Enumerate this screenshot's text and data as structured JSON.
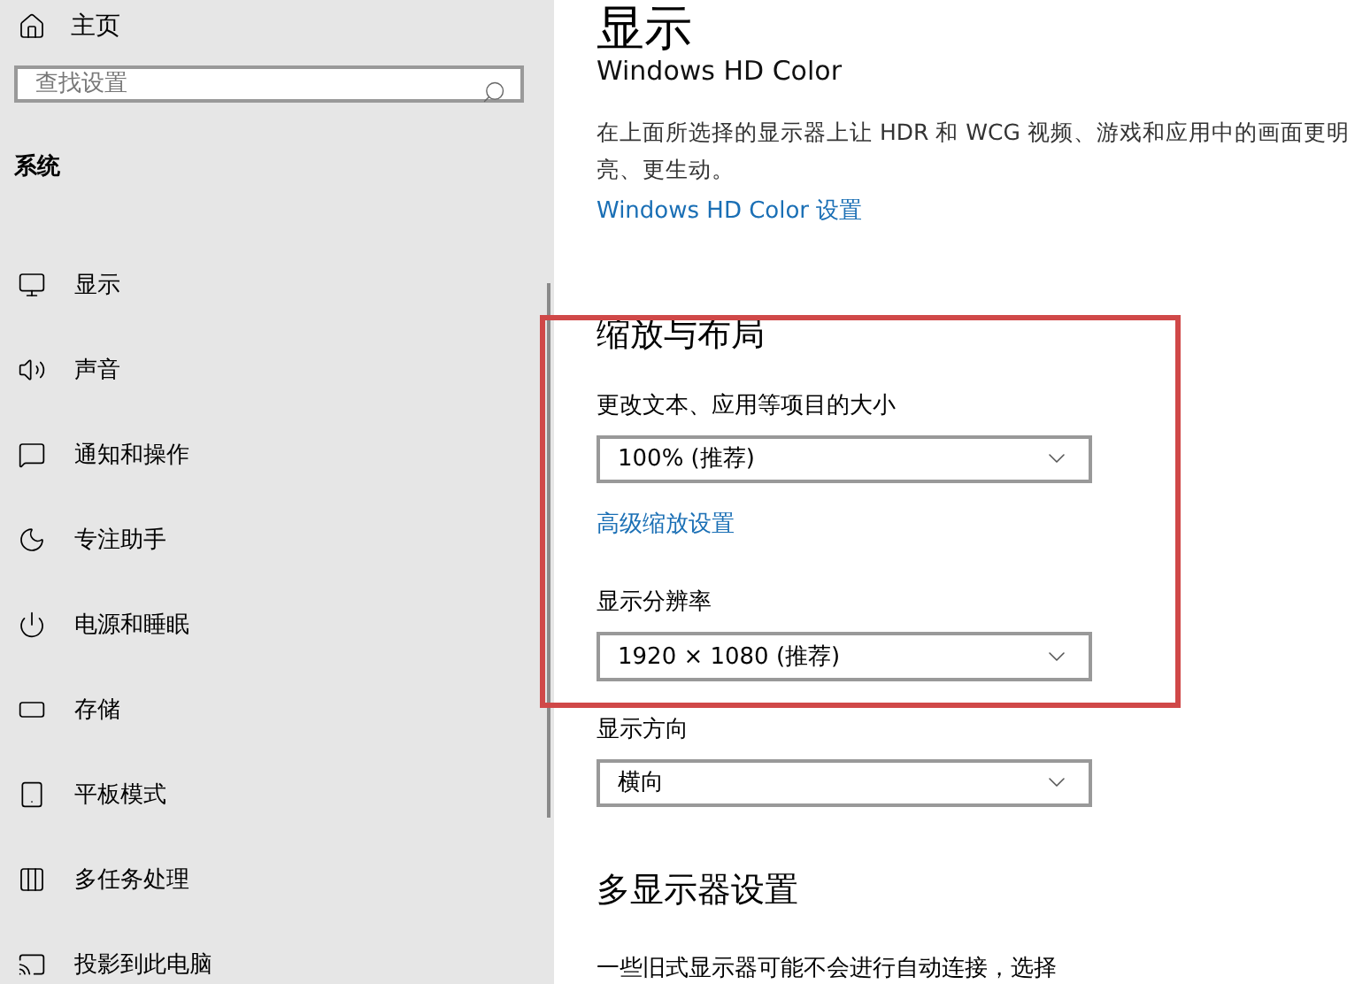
{
  "sidebar": {
    "home": "主页",
    "search": {
      "placeholder": "查找设置"
    },
    "section": "系统",
    "items": [
      {
        "label": "显示"
      },
      {
        "label": "声音"
      },
      {
        "label": "通知和操作"
      },
      {
        "label": "专注助手"
      },
      {
        "label": "电源和睡眠"
      },
      {
        "label": "存储"
      },
      {
        "label": "平板模式"
      },
      {
        "label": "多任务处理"
      },
      {
        "label": "投影到此电脑"
      }
    ]
  },
  "page": {
    "title": "显示",
    "hd_color": {
      "heading": "Windows HD Color",
      "description": "在上面所选择的显示器上让 HDR 和 WCG 视频、游戏和应用中的画面更明亮、更生动。",
      "link": "Windows HD Color 设置"
    },
    "scale_layout": {
      "heading": "缩放与布局",
      "fields": [
        {
          "kind": "dropdown",
          "label": "更改文本、应用等项目的大小",
          "value": "100% (推荐)"
        },
        {
          "kind": "link",
          "label": "高级缩放设置"
        },
        {
          "kind": "dropdown",
          "label": "显示分辨率",
          "value": "1920 × 1080 (推荐)"
        },
        {
          "kind": "dropdown",
          "label": "显示方向",
          "value": "横向"
        }
      ]
    },
    "multi_display": {
      "heading": "多显示器设置",
      "description": "一些旧式显示器可能不会进行自动连接，选择"
    }
  },
  "annotation": {
    "kind": "frame"
  }
}
